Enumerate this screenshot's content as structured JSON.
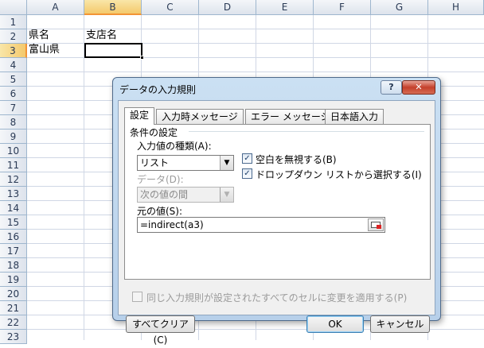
{
  "sheet": {
    "columns": [
      "A",
      "B",
      "C",
      "D",
      "E",
      "F",
      "G",
      "H"
    ],
    "rows": [
      "1",
      "2",
      "3",
      "4",
      "5",
      "6",
      "7",
      "8",
      "9",
      "10",
      "11",
      "12",
      "13",
      "14",
      "15",
      "16",
      "17",
      "18",
      "19",
      "20",
      "21",
      "22",
      "23"
    ],
    "cells": {
      "a2": "県名",
      "b2": "支店名",
      "a3": "富山県"
    }
  },
  "dialog": {
    "title": "データの入力規則",
    "help": "?",
    "close": "✕",
    "tabs": [
      "設定",
      "入力時メッセージ",
      "エラー メッセージ",
      "日本語入力"
    ],
    "section": "条件の設定",
    "allow_label": "入力値の種類(A):",
    "allow_value": "リスト",
    "ignore_blank_label": "空白を無視する(B)",
    "dropdown_label": "ドロップダウン リストから選択する(I)",
    "data_label": "データ(D):",
    "data_value": "次の値の間",
    "source_label": "元の値(S):",
    "source_value": "=indirect(a3)",
    "apply_all_label": "同じ入力規則が設定されたすべてのセルに変更を適用する(P)",
    "clear_all": "すべてクリア(C)",
    "ok": "OK",
    "cancel": "キャンセル"
  }
}
